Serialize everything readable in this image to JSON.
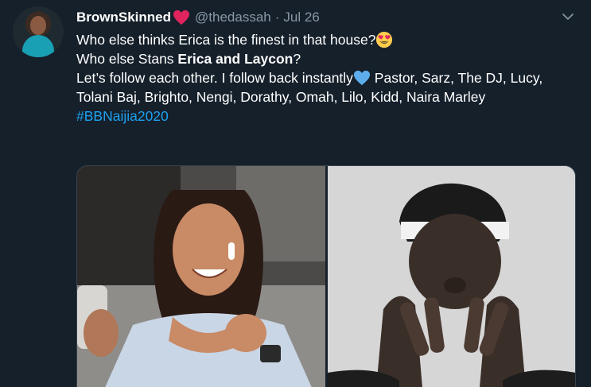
{
  "tweet": {
    "display_name": "BrownSkinned",
    "handle": "@thedassah",
    "separator": "·",
    "date": "Jul 26",
    "line1": "Who else thinks Erica is the finest in that house?",
    "line2_prefix": "Who else Stans ",
    "line2_bold": "Erica and Laycon",
    "line2_suffix": "?",
    "line3_prefix": "Let’s follow each other. I follow back instantly",
    "line3_suffix": " Pastor, Sarz, The DJ, Lucy, Tolani Baj, Brighto, Nengi, Dorathy, Omah, Lilo, Kidd, Naira Marley",
    "hashtag": "#BBNaijia2020"
  },
  "icons": {
    "name_badge": "red-heart-icon",
    "emoji_1": "heart-eyes-emoji-icon",
    "emoji_2": "blue-heart-icon",
    "menu": "chevron-down-icon"
  },
  "colors": {
    "background": "#15202b",
    "text": "#ffffff",
    "muted": "#8899a6",
    "link": "#1da1f2",
    "heart_red": "#e0245e",
    "heart_blue": "#5dadec"
  }
}
